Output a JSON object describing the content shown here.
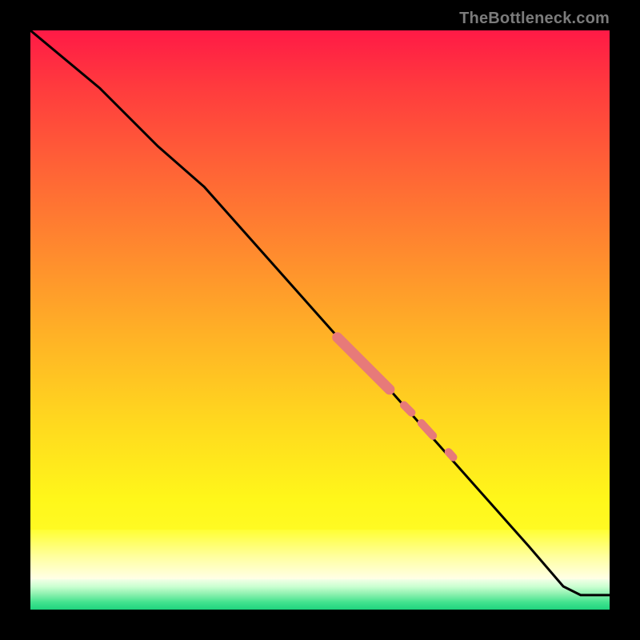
{
  "attribution": "TheBottleneck.com",
  "chart_data": {
    "type": "line",
    "title": "",
    "xlabel": "",
    "ylabel": "",
    "xlim": [
      0,
      100
    ],
    "ylim": [
      0,
      100
    ],
    "curve": {
      "x": [
        0,
        12,
        22,
        30,
        38,
        46,
        54,
        62,
        70,
        78,
        86,
        92,
        95,
        100
      ],
      "y": [
        100,
        90,
        80,
        73,
        64,
        55,
        46,
        38,
        29,
        20,
        11,
        4,
        2.5,
        2.5
      ]
    },
    "highlight_segments": [
      {
        "x0": 53,
        "y0": 47,
        "x1": 62,
        "y1": 38,
        "thick": true
      },
      {
        "x0": 64.5,
        "y0": 35.3,
        "x1": 65.8,
        "y1": 34.0,
        "thick": false
      },
      {
        "x0": 67.5,
        "y0": 32.2,
        "x1": 69.5,
        "y1": 30.0,
        "thick": false
      },
      {
        "x0": 72.2,
        "y0": 27.2,
        "x1": 73.0,
        "y1": 26.3,
        "thick": false
      }
    ],
    "colors": {
      "curve": "#000000",
      "highlight": "#e77a79",
      "grad_top": "#ff1a46",
      "grad_mid": "#ffff33",
      "grad_bottom": "#1fd47e"
    }
  }
}
